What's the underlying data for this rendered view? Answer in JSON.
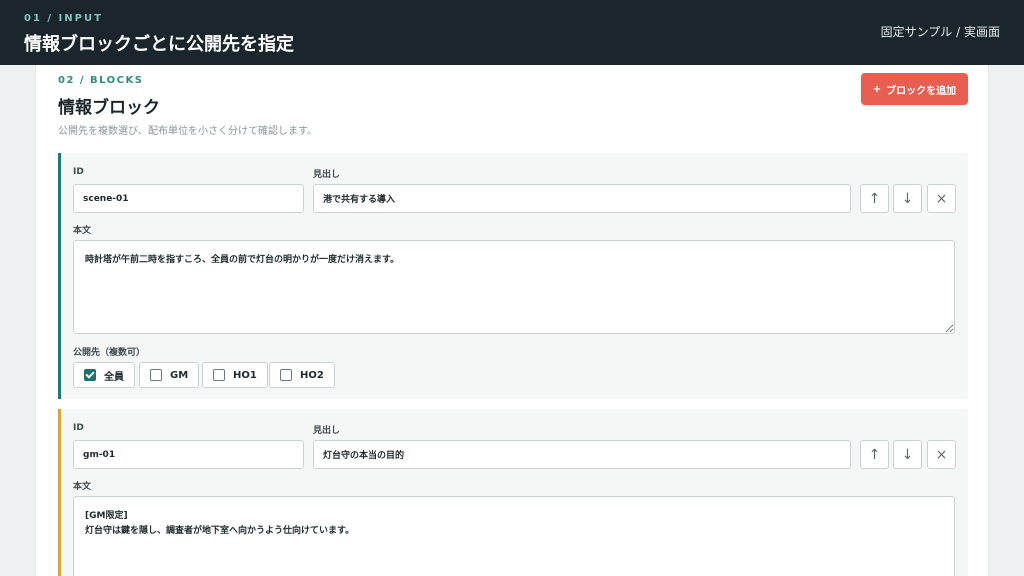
{
  "header": {
    "step": "01 / INPUT",
    "title": "情報ブロックごとに公開先を指定",
    "mode": "固定サンプル / 実画面"
  },
  "section": {
    "step": "02 / BLOCKS",
    "title": "情報ブロック",
    "description": "公開先を複数選び、配布単位を小さく分けて確認します。",
    "add_button": {
      "icon": "+",
      "label": "ブロックを追加"
    }
  },
  "labels": {
    "id": "ID",
    "heading": "見出し",
    "body": "本文",
    "audience": "公開先（複数可）"
  },
  "controls": {
    "up": "↑",
    "down": "↓",
    "remove": "×"
  },
  "colors": {
    "block1_accent": "#1f7a74",
    "block2_accent": "#e0a33a",
    "add_button": "#e85f52"
  },
  "blocks": [
    {
      "id": "scene-01",
      "heading": "港で共有する導入",
      "body": "時計塔が午前二時を指すころ、全員の前で灯台の明かりが一度だけ消えます。",
      "audience": [
        {
          "label": "全員",
          "checked": true
        },
        {
          "label": "GM",
          "checked": false
        },
        {
          "label": "HO1",
          "checked": false
        },
        {
          "label": "HO2",
          "checked": false
        }
      ]
    },
    {
      "id": "gm-01",
      "heading": "灯台守の本当の目的",
      "body": "[GM限定]\n灯台守は鍵を隠し、調査者が地下室へ向かうよう仕向けています。"
    }
  ]
}
